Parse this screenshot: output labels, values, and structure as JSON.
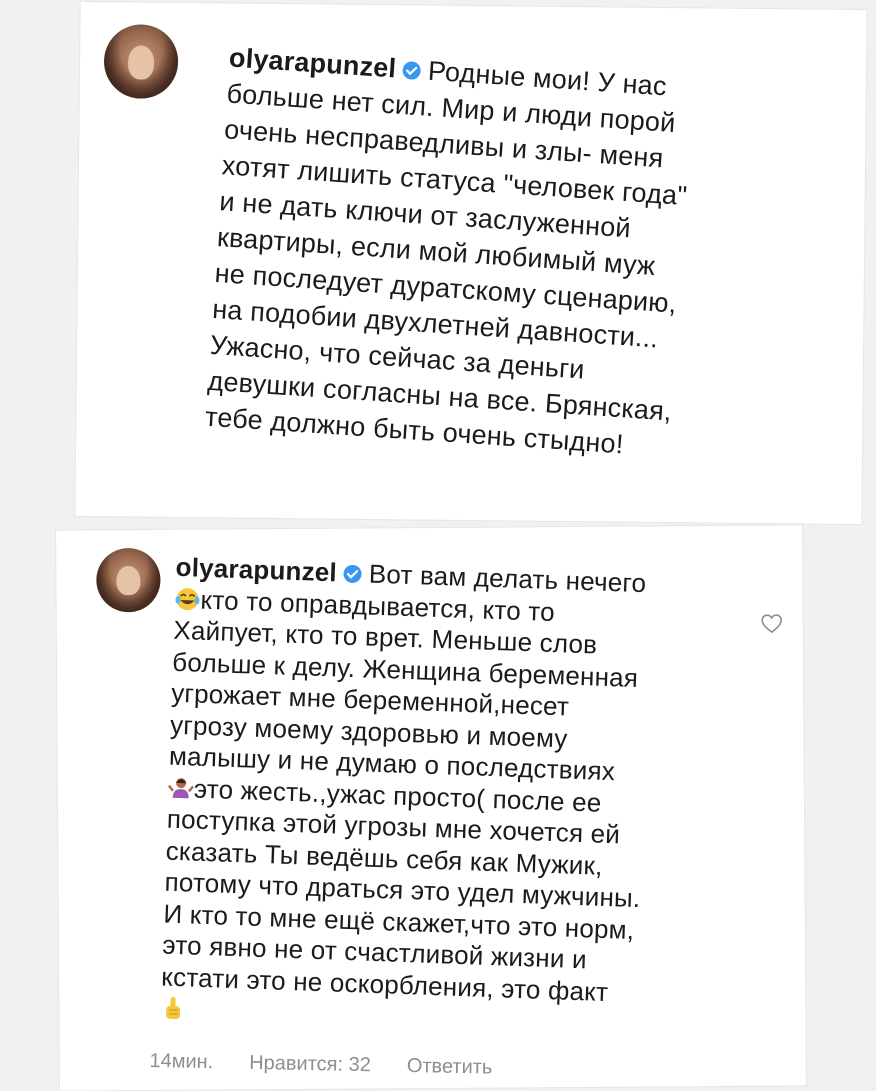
{
  "comment1": {
    "username": "olyarapunzel",
    "lines": [
      "Родные мои! У нас",
      "больше нет сил. Мир и люди порой",
      "очень несправедливы и злы- меня",
      "хотят лишить статуса \"человек года\"",
      "и не дать ключи от заслуженной",
      "квартиры, если мой любимый муж",
      "не последует дуратскому сценарию,",
      "на подобии двухлетней давности...",
      "Ужасно, что сейчас за деньги",
      "девушки согласны на все. Брянская,",
      "тебе должно быть очень стыдно!"
    ]
  },
  "comment2": {
    "username": "olyarapunzel",
    "line1": "Вот вам делать нечего",
    "line2": "кто то оправдывается, кто то",
    "line3": "Хайпует, кто то врет. Меньше слов",
    "line4": "больше к делу. Женщина беременная",
    "line5": "угрожает мне беременной,несет",
    "line6": "угрозу моему здоровью и моему",
    "line7": "малышу и не думаю о последствиях",
    "line8": "это жесть.,ужас просто( после ее",
    "line9": "поступка этой угрозы мне хочется ей",
    "line10": "сказать Ты ведёшь себя как Мужик,",
    "line11": "потому что драться это удел мужчины.",
    "line12": "И кто то мне ещё скажет,что это норм,",
    "line13": "это явно не от счастливой жизни и",
    "line14": "кстати это не оскорбления, это факт",
    "time": "14мин.",
    "likes": "Нравится: 32",
    "reply": "Ответить"
  },
  "icons": {
    "verified": "verified-badge-icon",
    "emoji_laugh": "face-with-tears-of-joy-icon",
    "emoji_shrug": "woman-shrugging-icon",
    "emoji_point": "index-pointing-up-icon",
    "heart": "heart-outline-icon"
  },
  "colors": {
    "verified": "#3897f0",
    "meta": "#8e8e8e",
    "text": "#1b1b1b"
  }
}
